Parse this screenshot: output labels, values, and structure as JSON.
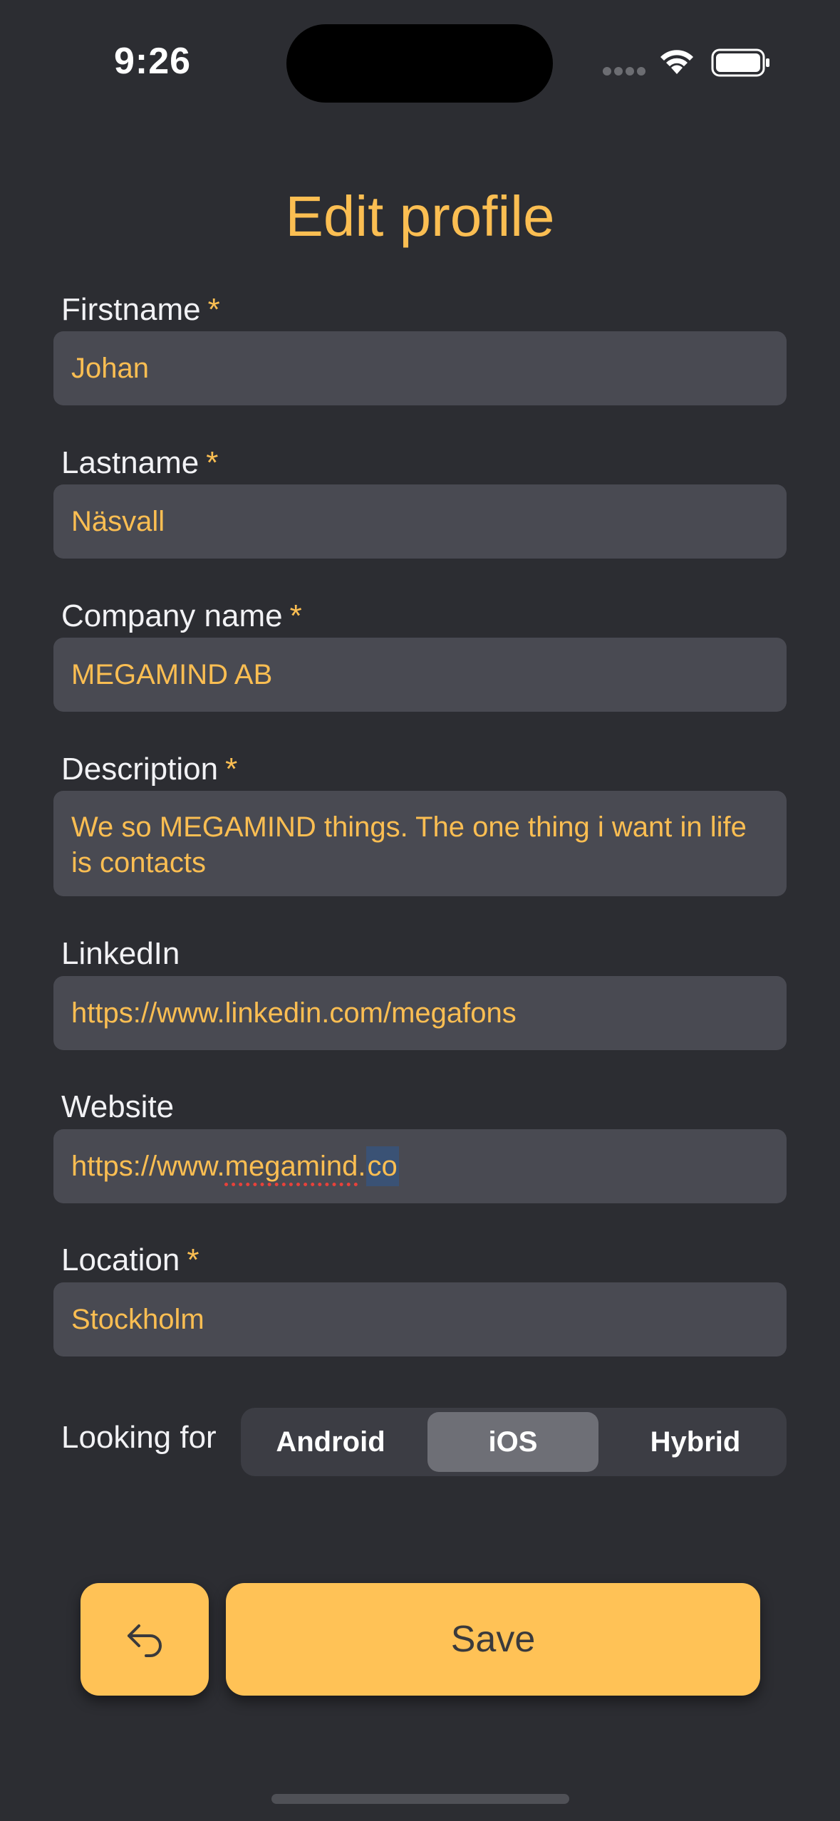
{
  "status_bar": {
    "time": "9:26"
  },
  "title": "Edit profile",
  "required_mark": "*",
  "fields": [
    {
      "label": "Firstname",
      "required": true,
      "value": "Johan"
    },
    {
      "label": "Lastname",
      "required": true,
      "value": "Näsvall"
    },
    {
      "label": "Company name",
      "required": true,
      "value": "MEGAMIND AB"
    },
    {
      "label": "Description",
      "required": true,
      "value": "We so MEGAMIND things. The one thing i want in life is contacts"
    },
    {
      "label": "LinkedIn",
      "required": false,
      "value": "https://www.linkedin.com/megafons"
    },
    {
      "label": "Website",
      "required": false,
      "value_prefix": "https://www.",
      "value_misspelled": "megamind",
      "value_middle": ".",
      "value_selected": "co"
    },
    {
      "label": "Location",
      "required": true,
      "value": "Stockholm"
    }
  ],
  "looking_for": {
    "label": "Looking for",
    "options": [
      "Android",
      "iOS",
      "Hybrid"
    ],
    "selected": "iOS"
  },
  "buttons": {
    "back_icon": "undo-arrow-icon",
    "save_label": "Save"
  },
  "colors": {
    "background": "#2c2d32",
    "accent": "#fbbe52",
    "input_bg": "#494a52",
    "button_bg": "#ffc256"
  }
}
